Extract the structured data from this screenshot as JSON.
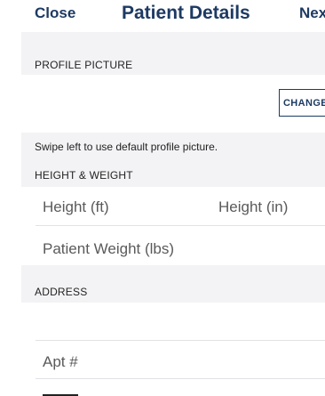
{
  "nav": {
    "close_label": "Close",
    "title": "Patient Details",
    "next_label": "Nex"
  },
  "profile": {
    "section_header": "PROFILE PICTURE",
    "change_label": "CHANGE",
    "hint": "Swipe left to use default profile picture."
  },
  "height_weight": {
    "section_header": "HEIGHT & WEIGHT",
    "height_ft_placeholder": "Height (ft)",
    "height_in_placeholder": "Height (in)",
    "weight_placeholder": "Patient Weight (lbs)"
  },
  "address": {
    "section_header": "ADDRESS",
    "street_value": "",
    "apt_placeholder": "Apt #"
  }
}
